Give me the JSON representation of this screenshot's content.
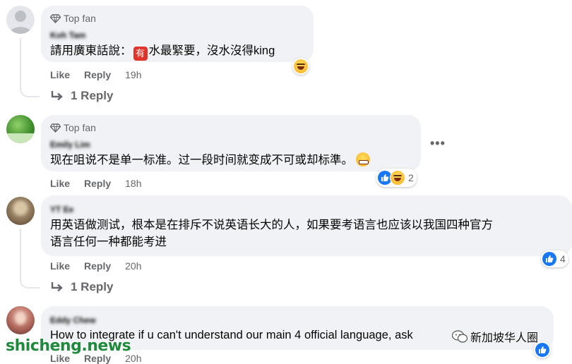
{
  "comments": [
    {
      "badge": "Top fan",
      "author": "Koh Tam",
      "text_before": "請用廣東話說：",
      "inline_icon": "有",
      "text_after": "水最緊要，沒水沒得king",
      "actions": {
        "like": "Like",
        "reply": "Reply",
        "time": "19h"
      },
      "reaction_icon": "haha-emoji",
      "replies_label": "1 Reply"
    },
    {
      "badge": "Top fan",
      "author": "Emily Lim",
      "text": "现在咀说不是单一标准。过一段时间就变成不可或却标準。",
      "text_emoji": "grimace",
      "actions": {
        "like": "Like",
        "reply": "Reply",
        "time": "18h"
      },
      "reaction_count": "2",
      "more_label": "•••"
    },
    {
      "author": "YT Ee",
      "line1": "用英语做测试，根本是在排斥不说英语长大的人，如果要考语言也应该以我国四种官方",
      "line2": "语言任何一种都能考进",
      "actions": {
        "like": "Like",
        "reply": "Reply",
        "time": "20h"
      },
      "reaction_count": "4",
      "replies_label": "1 Reply"
    },
    {
      "author": "Eddy Chew",
      "text": "How to integrate if u can't understand our main 4 official language, ask",
      "actions": {
        "like": "Like",
        "reply": "Reply",
        "time": "20h"
      }
    }
  ],
  "watermark": {
    "site": "shicheng.news",
    "channel": "新加坡华人圈"
  },
  "colors": {
    "bubble": "#f0f2f5",
    "meta_gray": "#65676b",
    "like_blue": "#1877f2",
    "watermark_green": "#1e8a3c"
  }
}
